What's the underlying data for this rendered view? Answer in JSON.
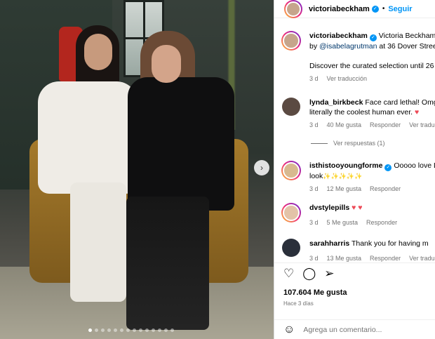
{
  "post": {
    "author": "victoriabeckham",
    "follow_label": "Seguir",
    "separator": "•",
    "carousel_dots": 14,
    "carousel_active_index": 0
  },
  "caption": {
    "username": "victoriabeckham",
    "line1": "Victoria Beckham",
    "line2_prefix": "by",
    "line2_mention": "@isabelagrutman",
    "line2_suffix": "at 36 Dover Stree",
    "line3": "Discover the curated selection until 26",
    "time": "3 d",
    "translate": "Ver traducción"
  },
  "comments": [
    {
      "username": "lynda_birkbeck",
      "text": "Face card lethal! Omg",
      "text2": "literally the coolest human ever.",
      "emoji": "♥",
      "time": "3 d",
      "likes": "40 Me gusta",
      "reply": "Responder",
      "translate": "Ver traduc"
    },
    {
      "username": "isthistooyoungforme",
      "text": "Ooooo love L",
      "text2": "look",
      "sparkles": "✨✨✨✨✨",
      "time": "3 d",
      "likes": "12 Me gusta",
      "reply": "Responder"
    },
    {
      "username": "dvstylepills",
      "text": "♥ ♥",
      "time": "3 d",
      "likes": "5 Me gusta",
      "reply": "Responder"
    },
    {
      "username": "sarahharris",
      "text": "Thank you for having m",
      "time": "3 d",
      "likes": "13 Me gusta",
      "reply": "Responder",
      "translate": "Ver traduc"
    }
  ],
  "replies_label": "Ver respuestas (1)",
  "footer": {
    "likes": "107.604 Me gusta",
    "date": "Hace 3 días",
    "comment_placeholder": "Agrega un comentario..."
  },
  "icons": {
    "like": "heart-icon",
    "comment": "comment-icon",
    "share": "share-icon",
    "emoji": "emoji-icon",
    "next": "chevron-right-icon"
  },
  "colors": {
    "link_blue": "#0095f6",
    "like_red": "#ed4956",
    "muted": "#737373"
  }
}
